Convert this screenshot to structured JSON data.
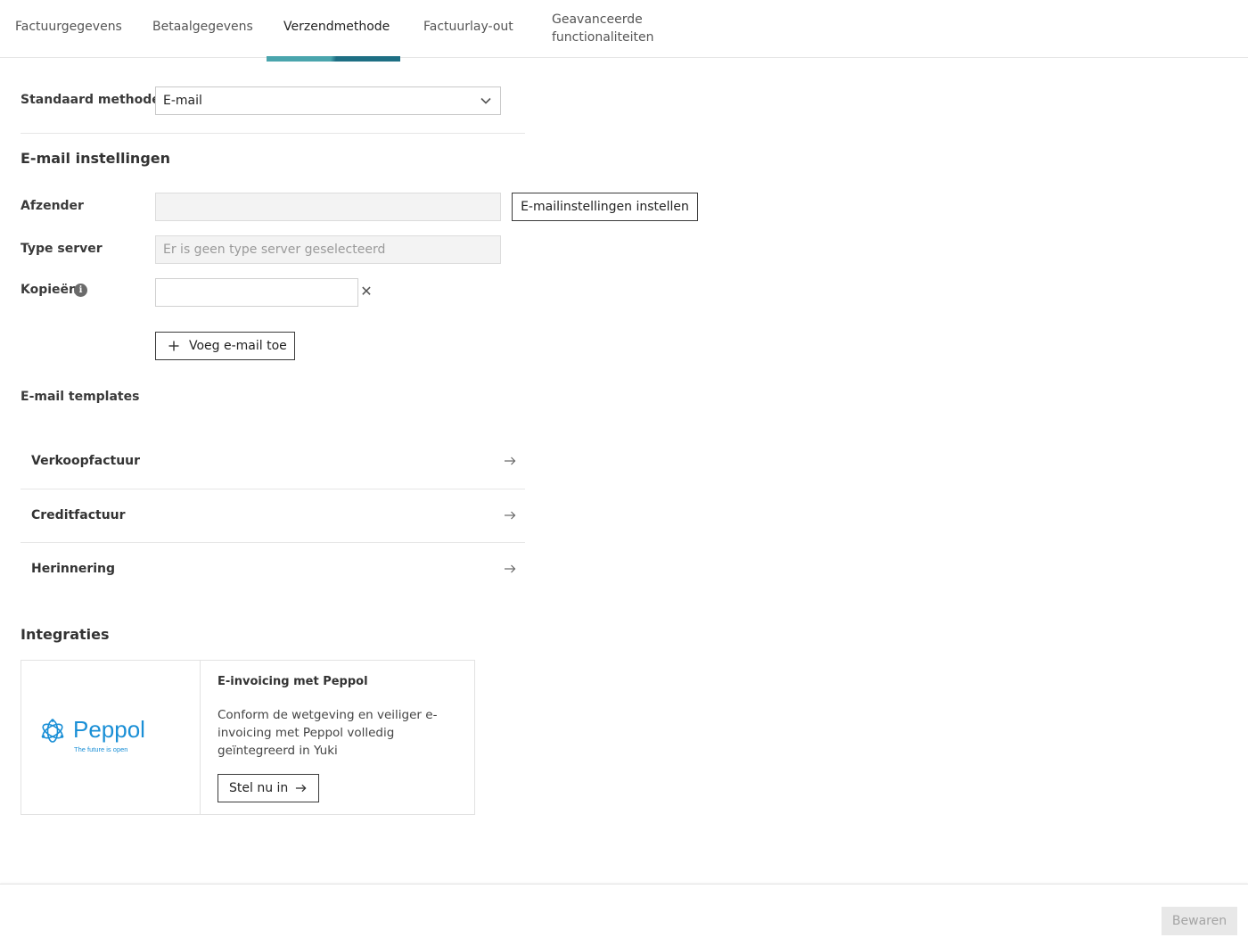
{
  "tabs": [
    {
      "label": "Factuurgegevens"
    },
    {
      "label": "Betaalgegevens"
    },
    {
      "label": "Verzendmethode",
      "active": true
    },
    {
      "label": "Factuurlay-out"
    },
    {
      "label": "Geavanceerde functionaliteiten"
    }
  ],
  "form": {
    "method_label": "Standaard methode",
    "method_value": "E-mail"
  },
  "email": {
    "section_title": "E-mail instellingen",
    "sender_label": "Afzender",
    "sender_value": "",
    "settings_button": "E-mailinstellingen instellen",
    "server_label": "Type server",
    "server_placeholder": "Er is geen type server geselecteerd",
    "copies_label": "Kopieën",
    "copies_value": "",
    "add_email_button": "Voeg e-mail toe"
  },
  "templates": {
    "title": "E-mail templates",
    "items": [
      {
        "label": "Verkoopfactuur"
      },
      {
        "label": "Creditfactuur"
      },
      {
        "label": "Herinnering"
      }
    ]
  },
  "integrations": {
    "title": "Integraties",
    "card": {
      "logo_text": "Peppol",
      "logo_tagline": "The future is open",
      "title": "E-invoicing met Peppol",
      "description": "Conform de wetgeving en veiliger e-invoicing met Peppol volledig geïntegreerd in Yuki",
      "button": "Stel nu in"
    }
  },
  "footer": {
    "save_button": "Bewaren"
  },
  "colors": {
    "tab_accent_light": "#4aa5ad",
    "tab_accent_dark": "#1e6f84",
    "peppol_blue": "#1a8fd6"
  }
}
